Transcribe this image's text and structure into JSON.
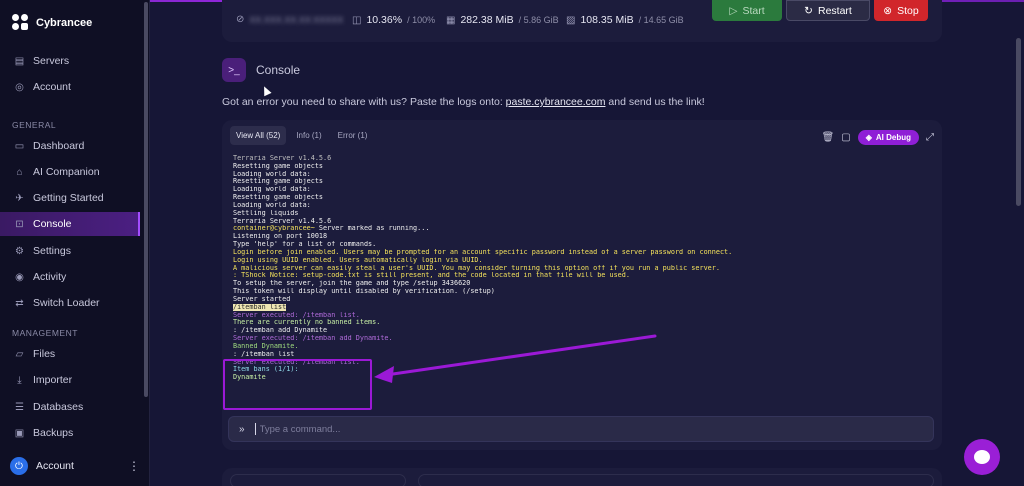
{
  "brand": {
    "name": "Cybrancee"
  },
  "sidebar": {
    "top_items": [
      {
        "label": "Servers",
        "icon": "servers-icon"
      },
      {
        "label": "Account",
        "icon": "account-icon"
      }
    ],
    "general_label": "GENERAL",
    "general_items": [
      {
        "label": "Dashboard",
        "icon": "dashboard-icon"
      },
      {
        "label": "AI Companion",
        "icon": "ai-icon"
      },
      {
        "label": "Getting Started",
        "icon": "rocket-icon"
      },
      {
        "label": "Console",
        "icon": "terminal-icon",
        "active": true
      },
      {
        "label": "Settings",
        "icon": "gear-icon"
      },
      {
        "label": "Activity",
        "icon": "eye-icon"
      },
      {
        "label": "Switch Loader",
        "icon": "switch-icon"
      }
    ],
    "management_label": "MANAGEMENT",
    "management_items": [
      {
        "label": "Files",
        "icon": "folder-icon"
      },
      {
        "label": "Importer",
        "icon": "download-icon"
      },
      {
        "label": "Databases",
        "icon": "database-icon"
      },
      {
        "label": "Backups",
        "icon": "archive-icon"
      }
    ],
    "account_label": "Account"
  },
  "stats": {
    "address": "XX.XXX.XX.XX:XXXXX",
    "cpu": "10.36%",
    "cpu_limit": "/ 100%",
    "memory": "282.38 MiB",
    "memory_limit": "/ 5.86 GiB",
    "disk": "108.35 MiB",
    "disk_limit": "/ 14.65 GiB"
  },
  "power": {
    "start": "Start",
    "restart": "Restart",
    "stop": "Stop"
  },
  "console": {
    "title": "Console",
    "help_prefix": "Got an error you need to share with us? Paste the logs onto: ",
    "help_link": "paste.cybrancee.com",
    "help_suffix": " and send us the link!",
    "tabs": [
      "View All (52)",
      "Info (1)",
      "Error (1)"
    ],
    "ai_debug": "AI Debug",
    "input_placeholder": "Type a command...",
    "lines": [
      {
        "text": "Terraria Server v1.4.5.6",
        "color": "gray"
      },
      {
        "text": "Resetting game objects",
        "color": "white"
      },
      {
        "text": "Loading world data:",
        "color": "white"
      },
      {
        "text": "Resetting game objects",
        "color": "white"
      },
      {
        "text": "Loading world data:",
        "color": "white"
      },
      {
        "text": "Resetting game objects",
        "color": "white"
      },
      {
        "text": "Loading world data:",
        "color": "white"
      },
      {
        "text": "Settling liquids",
        "color": "white"
      },
      {
        "text": "Terraria Server v1.4.5.6",
        "color": "white"
      },
      {
        "text": "container@cybrancee~ Server marked as running...",
        "color": "white",
        "prefix": "container@cybrancee~",
        "prefix_color": "yellow"
      },
      {
        "text": "Listening on port 10018",
        "color": "white"
      },
      {
        "text": "Type 'help' for a list of commands.",
        "color": "white"
      },
      {
        "text": "Login before join enabled. Users may be prompted for an account specific password instead of a server password on connect.",
        "color": "yellow"
      },
      {
        "text": "Login using UUID enabled. Users automatically login via UUID.",
        "color": "yellow"
      },
      {
        "text": "A malicious server can easily steal a user's UUID. You may consider turning this option off if you run a public server.",
        "color": "yellow"
      },
      {
        "text": ": TShock Notice: setup-code.txt is still present, and the code located in that file will be used.",
        "color": "yellow"
      },
      {
        "text": "To setup the server, join the game and type /setup 3436620",
        "color": "white"
      },
      {
        "text": "This token will display until disabled by verification. (/setup)",
        "color": "white"
      },
      {
        "text": "Server started",
        "color": "white"
      },
      {
        "text": "/itemban list",
        "color": "white",
        "highlight": true
      },
      {
        "text": "Server executed: /itemban list.",
        "color": "purple"
      },
      {
        "text": "There are currently no banned items.",
        "color": "lgreen"
      },
      {
        "text": ": /itemban add Dynamite",
        "color": "white"
      },
      {
        "text": "Server executed: /itemban add Dynamite.",
        "color": "purple"
      },
      {
        "text": "Banned Dynamite.",
        "color": "green"
      },
      {
        "text": ": /itemban list",
        "color": "white"
      },
      {
        "text": "Server executed: /itemban list.",
        "color": "purple"
      },
      {
        "text": "Item bans (1/1):",
        "color": "cyan"
      },
      {
        "text": "Dynamite",
        "color": "lgreen"
      }
    ]
  },
  "colors": {
    "accent": "#9b19d6",
    "stop": "#d1262b",
    "start": "#2b7a3d"
  }
}
